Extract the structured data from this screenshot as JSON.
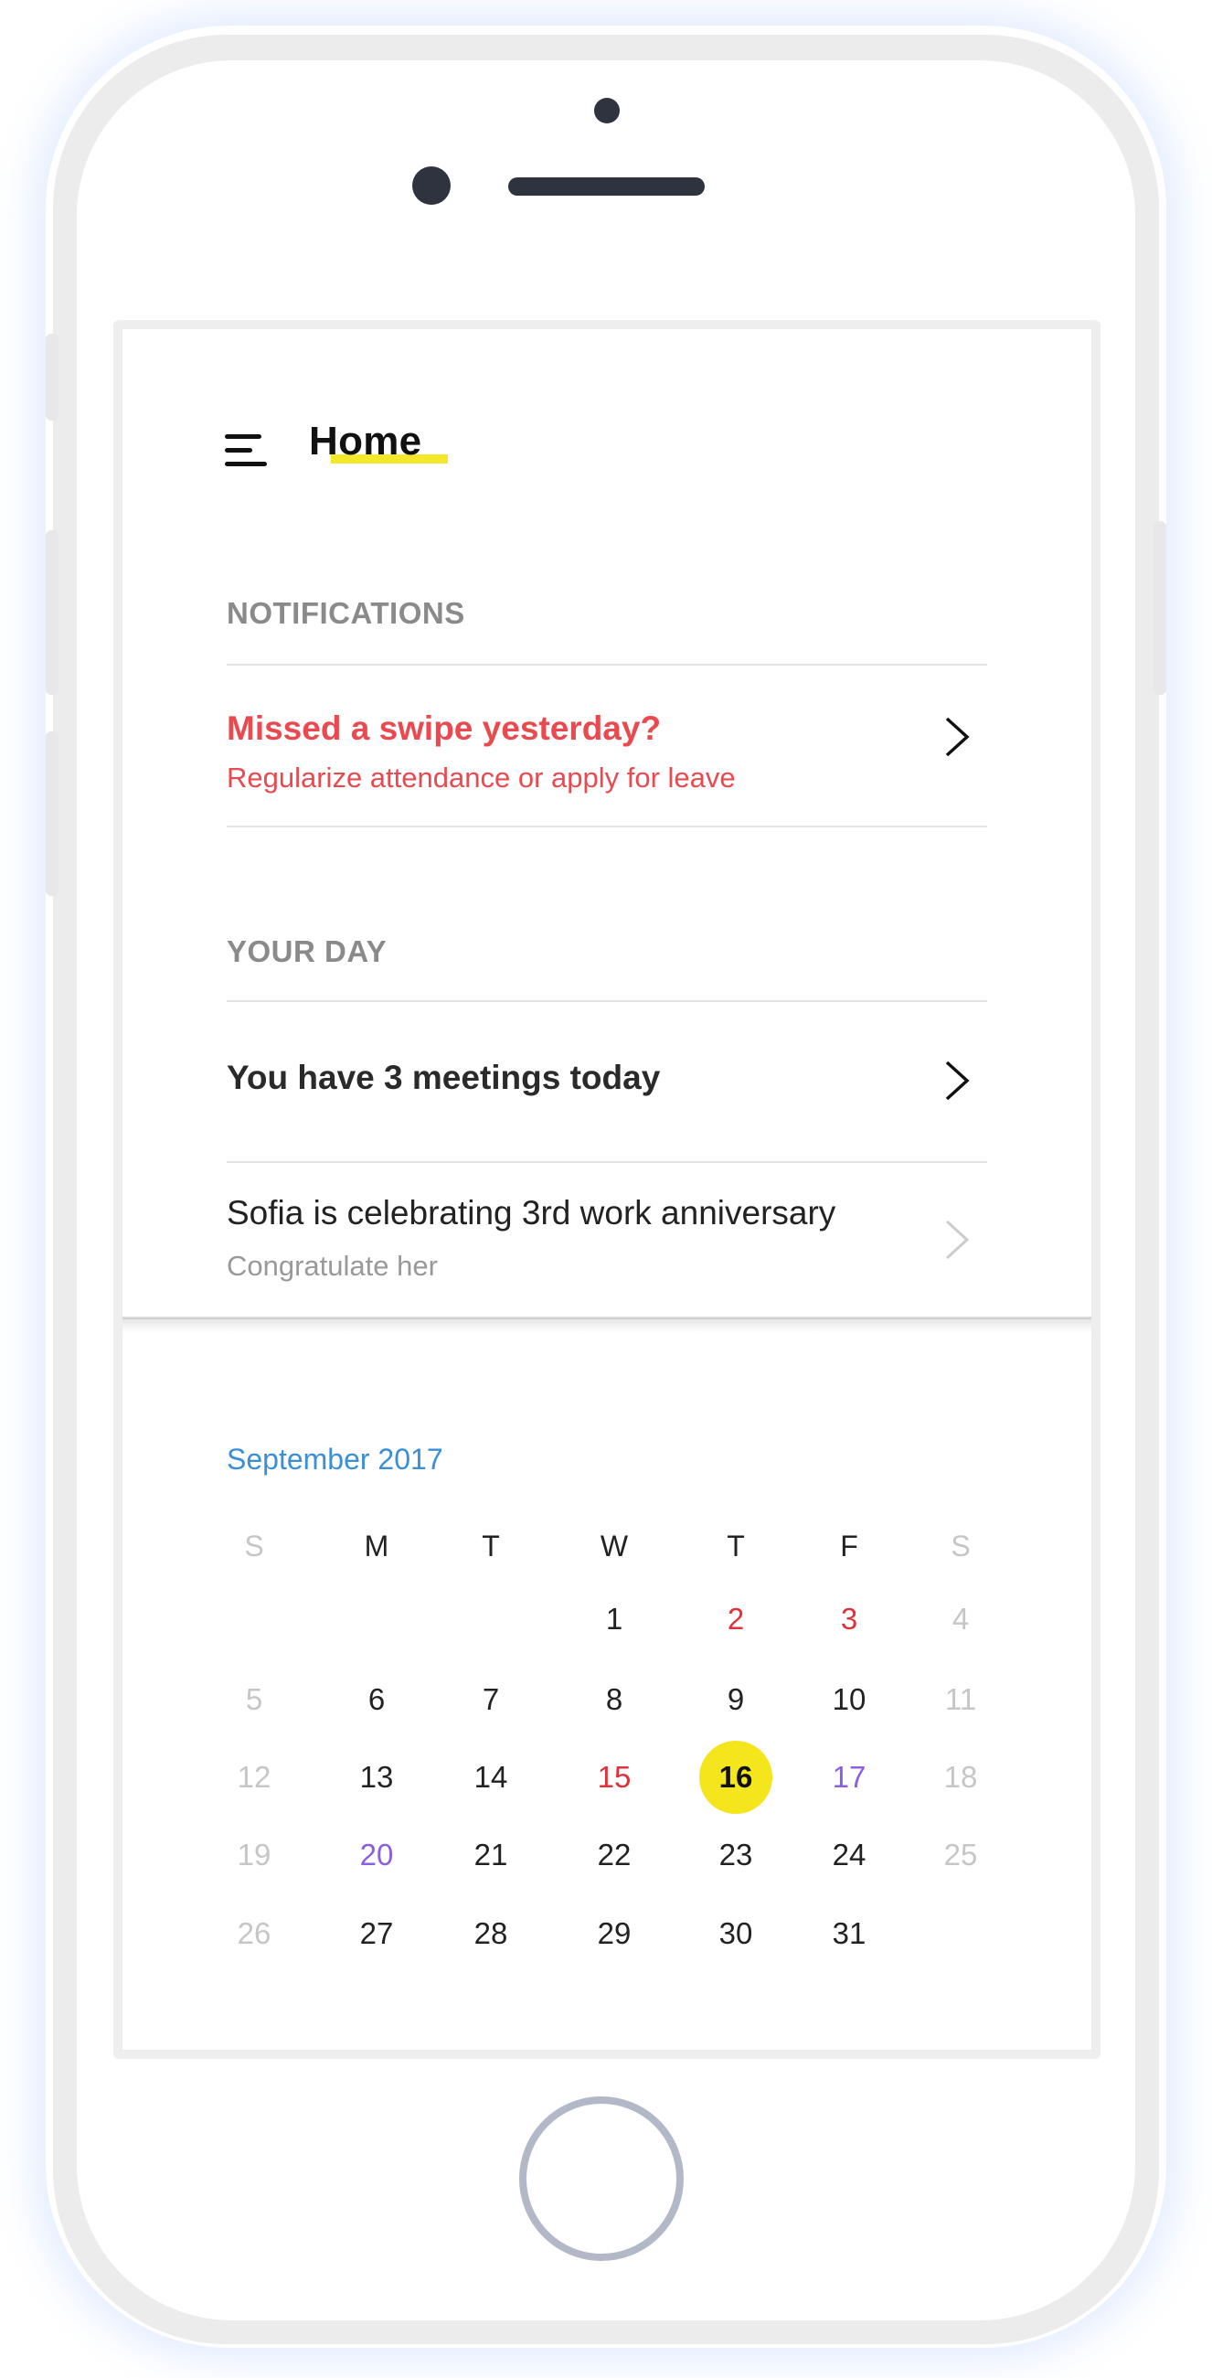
{
  "header": {
    "title": "Home",
    "menu_icon": "hamburger-menu-icon"
  },
  "notifications": {
    "label": "NOTIFICATIONS",
    "items": [
      {
        "title": "Missed a swipe yesterday?",
        "subtitle": "Regularize attendance or apply for leave",
        "color": "#ea4a4f"
      }
    ]
  },
  "your_day": {
    "label": "YOUR DAY",
    "items": [
      {
        "title": "You have 3 meetings today"
      },
      {
        "title": "Sofia is celebrating 3rd work anniversary",
        "subtitle": "Congratulate her"
      }
    ]
  },
  "calendar": {
    "month_label": "September 2017",
    "weekdays": [
      "S",
      "M",
      "T",
      "W",
      "T",
      "F",
      "S"
    ],
    "weeks": [
      [
        "",
        "",
        "",
        "1",
        "2",
        "3",
        "4"
      ],
      [
        "5",
        "6",
        "7",
        "8",
        "9",
        "10",
        "11"
      ],
      [
        "12",
        "13",
        "14",
        "15",
        "16",
        "17",
        "18"
      ],
      [
        "19",
        "20",
        "21",
        "22",
        "23",
        "24",
        "25"
      ],
      [
        "26",
        "27",
        "28",
        "29",
        "30",
        "31",
        ""
      ]
    ],
    "today": "16",
    "red_days": [
      "2",
      "3",
      "15"
    ],
    "purple_days": [
      "17",
      "20"
    ],
    "muted_days": [
      "4",
      "5",
      "11",
      "12",
      "18",
      "19",
      "25",
      "26"
    ],
    "colors": {
      "today_bg": "#f5e51c",
      "red": "#e0323a",
      "purple": "#8a5fe0",
      "month": "#3a8fd8"
    }
  }
}
